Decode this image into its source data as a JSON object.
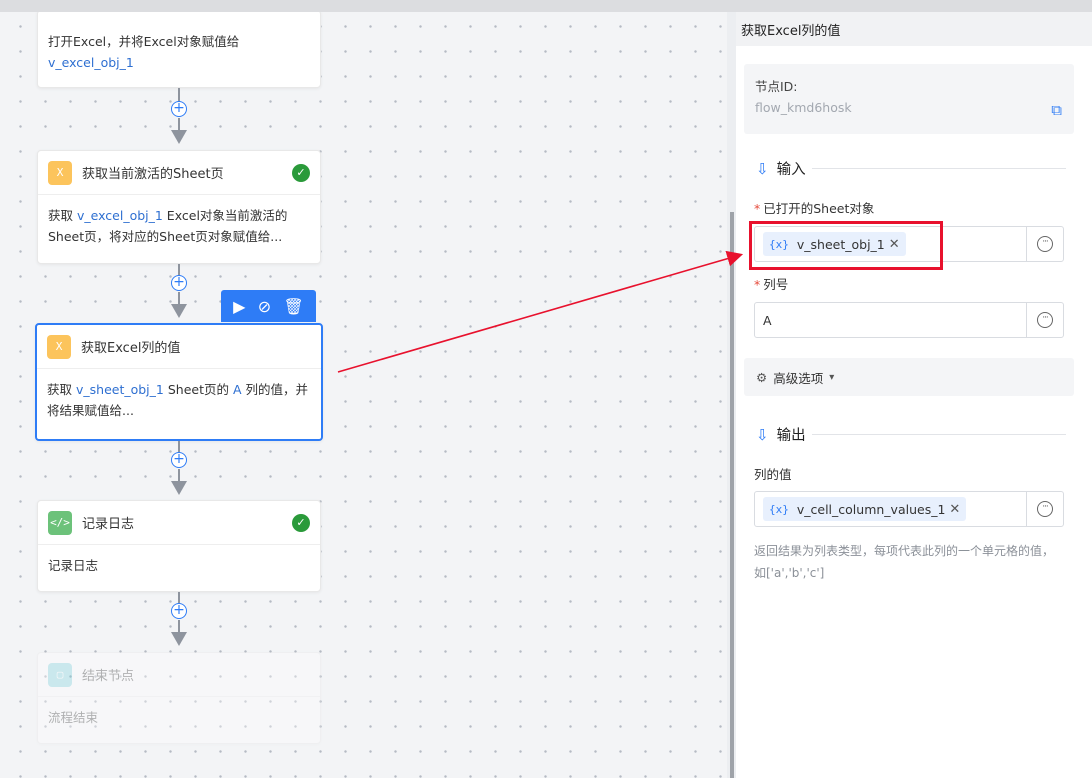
{
  "canvas": {
    "nodes": [
      {
        "id": "open-excel",
        "title": "",
        "body_parts": [
          {
            "text": "打开Excel，并将Excel对象赋值给",
            "var": false
          },
          {
            "text": "v_excel_obj_1",
            "var": true
          }
        ],
        "checked": false
      },
      {
        "id": "get-active-sheet",
        "title": "获取当前激活的Sheet页",
        "body_parts": [
          {
            "text": "获取 ",
            "var": false
          },
          {
            "text": "v_excel_obj_1",
            "var": true
          },
          {
            "text": " Excel对象当前激活的Sheet页，将对应的Sheet页对象赋值给...",
            "var": false
          }
        ],
        "checked": true
      },
      {
        "id": "get-column",
        "title": "获取Excel列的值",
        "body_parts": [
          {
            "text": "获取 ",
            "var": false
          },
          {
            "text": "v_sheet_obj_1",
            "var": true
          },
          {
            "text": " Sheet页的 ",
            "var": false
          },
          {
            "text": "A",
            "var": true
          },
          {
            "text": " 列的值，并将结果赋值给...",
            "var": false
          }
        ],
        "checked": false
      },
      {
        "id": "log",
        "title": "记录日志",
        "body_parts": [
          {
            "text": "记录日志",
            "var": false
          }
        ],
        "checked": true
      },
      {
        "id": "end",
        "title": "结束节点",
        "body_parts": [
          {
            "text": "流程结束",
            "var": false
          }
        ],
        "checked": false
      }
    ],
    "toolbar_icons": [
      "play-icon",
      "disable-icon",
      "delete-icon"
    ]
  },
  "panel": {
    "title": "获取Excel列的值",
    "node_id_label": "节点ID:",
    "node_id_value": "flow_kmd6hosk",
    "input_section": "输入",
    "field_sheet_label": "已打开的Sheet对象",
    "field_sheet_value": "v_sheet_obj_1",
    "field_column_label": "列号",
    "field_column_value": "A",
    "advanced_label": "高级选项",
    "output_section": "输出",
    "output_label": "列的值",
    "output_value": "v_cell_column_values_1",
    "var_icon": "{x}",
    "hint": "返回结果为列表类型，每项代表此列的一个单元格的值，如['a','b','c']"
  },
  "colors": {
    "accent": "#2e7cf6",
    "annotation": "#e8112d",
    "success": "#2a9a3a"
  }
}
